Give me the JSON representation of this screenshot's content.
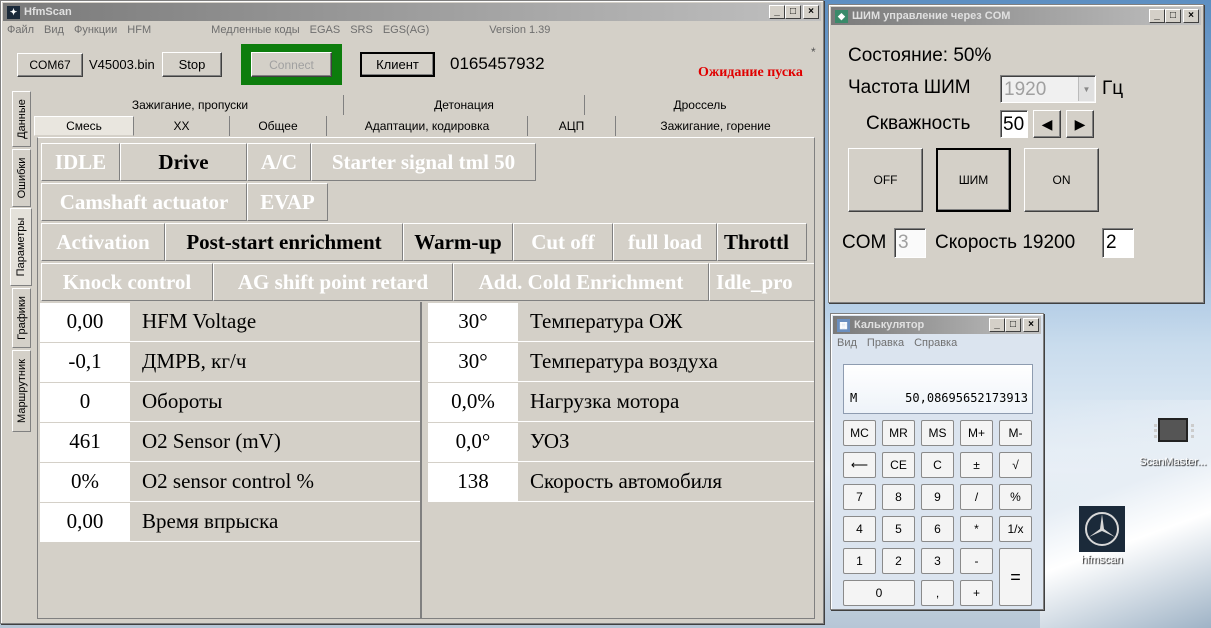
{
  "hfm": {
    "title": "HfmScan",
    "menu": [
      "Файл",
      "Вид",
      "Функции",
      "HFM",
      "Медленные коды",
      "EGAS",
      "SRS",
      "EGS(AG)",
      "Version 1.39"
    ],
    "com_button": "COM67",
    "file_name": "V45003.bin",
    "stop_button": "Stop",
    "connect_button": "Connect",
    "client_button": "Клиент",
    "serial": "0165457932",
    "status": "Ожидание пуска",
    "asterisk": "*",
    "vtabs": [
      "Данные",
      "Ошибки",
      "Параметры",
      "Графики",
      "Маршрутник"
    ],
    "tabs_top": [
      "Зажигание, пропуски",
      "Детонация",
      "Дроссель"
    ],
    "tabs_bottom": [
      "Смесь",
      "XX",
      "Общее",
      "Адаптации, кодировка",
      "АЦП",
      "Зажигание, горение"
    ],
    "row1": [
      "IDLE",
      "Drive",
      "A/C",
      "Starter signal tml 50"
    ],
    "row2": [
      "Camshaft actuator",
      "EVAP"
    ],
    "row3": [
      "Activation",
      "Post-start enrichment",
      "Warm-up",
      "Cut off",
      "full load",
      "Throttl"
    ],
    "row4": [
      "Knock control",
      "AG shift point retard",
      "Add. Cold Enrichment",
      "Idle_pro"
    ],
    "left_data": [
      {
        "value": "0,00",
        "label": "HFM Voltage"
      },
      {
        "value": "-0,1",
        "label": "ДМРВ, кг/ч"
      },
      {
        "value": "0",
        "label": "Обороты"
      },
      {
        "value": "461",
        "label": "O2 Sensor (mV)"
      },
      {
        "value": "0%",
        "label": "O2 sensor control %"
      },
      {
        "value": "0,00",
        "label": "Время впрыска"
      }
    ],
    "right_data": [
      {
        "value": "30°",
        "label": "Температура ОЖ"
      },
      {
        "value": "30°",
        "label": "Температура воздуха"
      },
      {
        "value": "0,0%",
        "label": "Нагрузка мотора"
      },
      {
        "value": "0,0°",
        "label": "УОЗ"
      },
      {
        "value": "138",
        "label": "Скорость автомобиля"
      }
    ]
  },
  "pwm": {
    "title": "ШИМ управление через COM",
    "state_label": "Состояние: 50%",
    "freq_label": "Частота ШИМ",
    "freq_value": "1920",
    "freq_unit": "Гц",
    "duty_label": "Скважность",
    "duty_value": "50",
    "btn_off": "OFF",
    "btn_pwm": "ШИМ",
    "btn_on": "ON",
    "com_label": "COM",
    "com_value": "3",
    "speed_label": "Скорость 19200",
    "speed_value": "2"
  },
  "calc": {
    "title": "Калькулятор",
    "menu": [
      "Вид",
      "Правка",
      "Справка"
    ],
    "memory": "M",
    "display": "50,08695652173913",
    "buttons": {
      "mc": "MC",
      "mr": "MR",
      "ms": "MS",
      "mplus": "M+",
      "mminus": "M-",
      "back": "⟵",
      "ce": "CE",
      "c": "C",
      "pm": "±",
      "sqrt": "√",
      "n7": "7",
      "n8": "8",
      "n9": "9",
      "div": "/",
      "pct": "%",
      "n4": "4",
      "n5": "5",
      "n6": "6",
      "mul": "*",
      "inv": "1/x",
      "n1": "1",
      "n2": "2",
      "n3": "3",
      "minus": "-",
      "eq": "=",
      "n0": "0",
      "dot": ",",
      "plus": "+"
    }
  },
  "desktop": {
    "icon1": "ScanMaster...",
    "icon2": "hfmscan"
  }
}
